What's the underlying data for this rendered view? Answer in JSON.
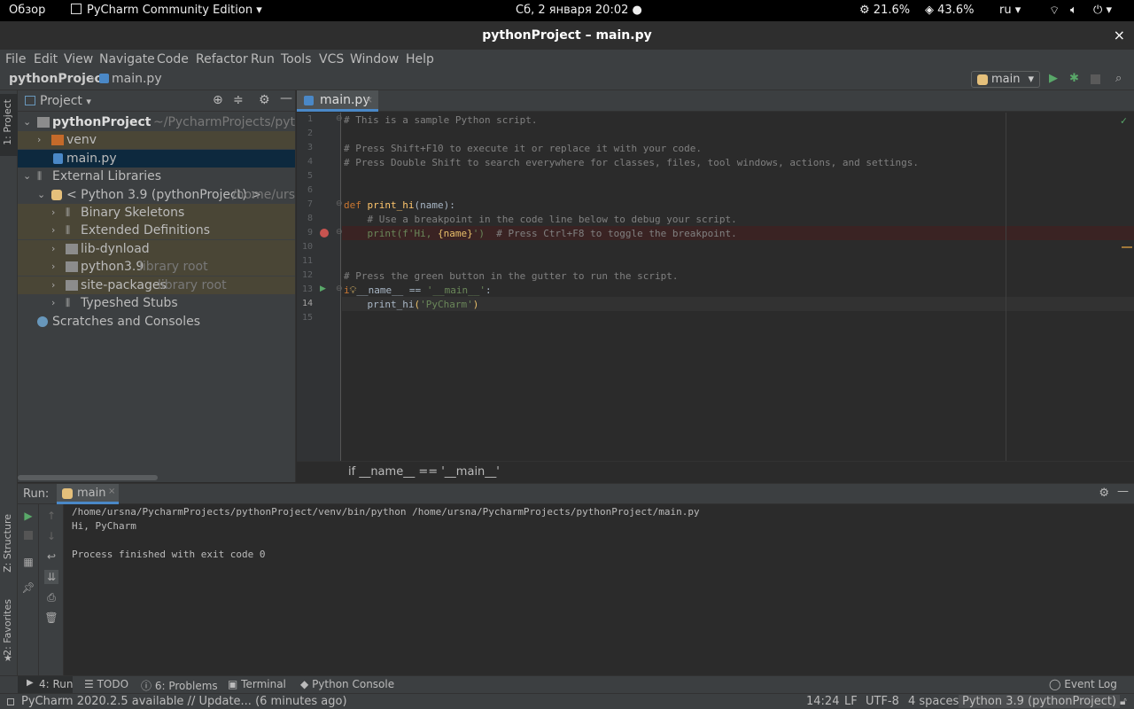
{
  "topbar": {
    "overview": "Обзор",
    "app_menu": "PyCharm Community Edition",
    "clock": "Сб, 2 января  20:02",
    "cpu": "21.6%",
    "mem": "43.6%",
    "lang": "ru"
  },
  "window": {
    "title": "pythonProject – main.py",
    "close": "×"
  },
  "menu": [
    "File",
    "Edit",
    "View",
    "Navigate",
    "Code",
    "Refactor",
    "Run",
    "Tools",
    "VCS",
    "Window",
    "Help"
  ],
  "nav": {
    "project": "pythonProject",
    "file": "main.py",
    "run_config": "main"
  },
  "sidebar": {
    "project_tab": "1: Project",
    "structure_tab": "Z: Structure",
    "favorites_tab": "2: Favorites"
  },
  "project_panel": {
    "title": "Project",
    "tree": [
      {
        "label": "pythonProject",
        "suffix": "~/PycharmProjects/pythonPro"
      },
      {
        "label": "venv"
      },
      {
        "label": "main.py"
      },
      {
        "label": "External Libraries"
      },
      {
        "label": "< Python 3.9 (pythonProject) >",
        "suffix": "/home/ursna"
      },
      {
        "label": "Binary Skeletons"
      },
      {
        "label": "Extended Definitions"
      },
      {
        "label": "lib-dynload"
      },
      {
        "label": "python3.9",
        "suffix": "library root"
      },
      {
        "label": "site-packages",
        "suffix": "library root"
      },
      {
        "label": "Typeshed Stubs"
      },
      {
        "label": "Scratches and Consoles"
      }
    ]
  },
  "editor": {
    "tab": "main.py",
    "line_numbers": [
      "1",
      "2",
      "3",
      "4",
      "5",
      "6",
      "7",
      "8",
      "9",
      "10",
      "11",
      "12",
      "13",
      "14",
      "15"
    ],
    "code": {
      "l1": "# This is a sample Python script.",
      "l3": "# Press Shift+F10 to execute it or replace it with your code.",
      "l4": "# Press Double Shift to search everywhere for classes, files, tool windows, actions, and settings.",
      "l7_kw": "def ",
      "l7_fn": "print_hi",
      "l7_rest": "(name):",
      "l8": "    # Use a breakpoint in the code line below to debug your script.",
      "l9_a": "    print(f'Hi, ",
      "l9_b": "{name}",
      "l9_c": "')",
      "l9_cmt": "  # Press Ctrl+F8 to toggle the breakpoint.",
      "l12": "# Press the green button in the gutter to run the script.",
      "l13_a": "i",
      "l13_b": "__name__ == ",
      "l13_str": "'__main__'",
      "l13_c": ":",
      "l14_a": "    print_hi",
      "l14_b": "(",
      "l14_str": "'PyCharm'",
      "l14_c": ")"
    },
    "breadcrumb": "if __name__ == '__main__'"
  },
  "run": {
    "label": "Run:",
    "tab": "main",
    "output": [
      "/home/ursna/PycharmProjects/pythonProject/venv/bin/python /home/ursna/PycharmProjects/pythonProject/main.py",
      "Hi, PyCharm",
      "",
      "Process finished with exit code 0"
    ]
  },
  "bottom_tabs": {
    "run": "4: Run",
    "todo": "TODO",
    "problems": "6: Problems",
    "terminal": "Terminal",
    "python_console": "Python Console",
    "event_log": "Event Log"
  },
  "status": {
    "message": "PyCharm 2020.2.5 available // Update... (6 minutes ago)",
    "position": "14:24",
    "line_sep": "LF",
    "encoding": "UTF-8",
    "indent": "4 spaces",
    "interpreter": "Python 3.9 (pythonProject)"
  },
  "colors": {
    "accent": "#4a88c7",
    "run_green": "#59a869",
    "breakpoint": "#c75450"
  }
}
